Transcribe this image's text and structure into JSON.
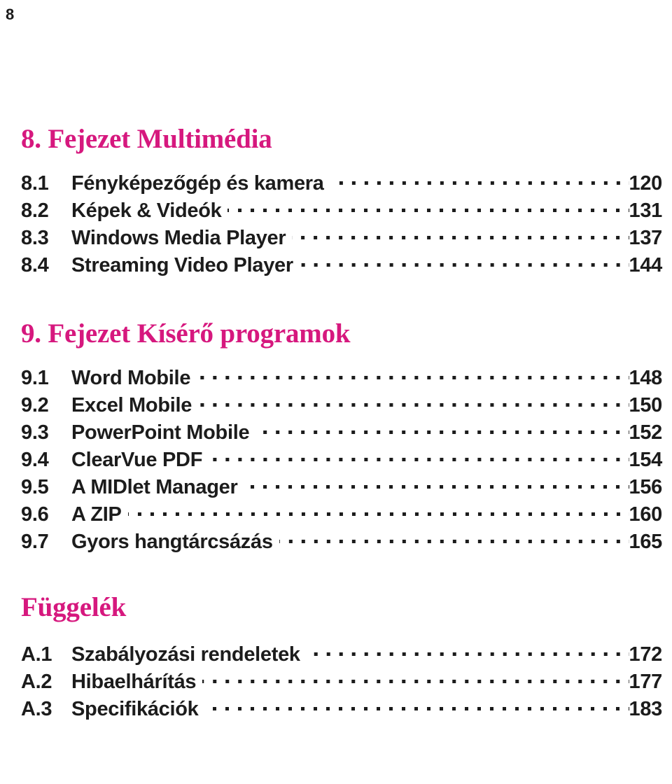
{
  "document": {
    "folio": "8",
    "type": "table-of-contents",
    "language": "hu"
  },
  "sections": [
    {
      "heading": "8. Fejezet Multimédia",
      "entries": [
        {
          "number": "8.1",
          "title": "Fényképezőgép és kamera",
          "page": "120"
        },
        {
          "number": "8.2",
          "title": "Képek & Videók",
          "page": "131"
        },
        {
          "number": "8.3",
          "title": "Windows Media Player",
          "page": "137"
        },
        {
          "number": "8.4",
          "title": "Streaming Video Player",
          "page": "144"
        }
      ]
    },
    {
      "heading": "9. Fejezet Kísérő programok",
      "entries": [
        {
          "number": "9.1",
          "title": "Word Mobile",
          "page": "148"
        },
        {
          "number": "9.2",
          "title": "Excel Mobile",
          "page": "150"
        },
        {
          "number": "9.3",
          "title": "PowerPoint Mobile",
          "page": "152"
        },
        {
          "number": "9.4",
          "title": "ClearVue PDF",
          "page": "154"
        },
        {
          "number": "9.5",
          "title": "A MIDlet Manager",
          "page": "156"
        },
        {
          "number": "9.6",
          "title": "A ZIP",
          "page": "160"
        },
        {
          "number": "9.7",
          "title": "Gyors hangtárcsázás",
          "page": "165"
        }
      ]
    },
    {
      "heading": "Függelék",
      "entries": [
        {
          "number": "A.1",
          "title": "Szabályozási rendeletek",
          "page": "172"
        },
        {
          "number": "A.2",
          "title": "Hibaelhárítás",
          "page": "177"
        },
        {
          "number": "A.3",
          "title": "Specifikációk",
          "page": "183"
        }
      ]
    }
  ],
  "colors": {
    "heading": "#d6187e",
    "body_text": "#1c1c1c",
    "background": "#ffffff"
  }
}
